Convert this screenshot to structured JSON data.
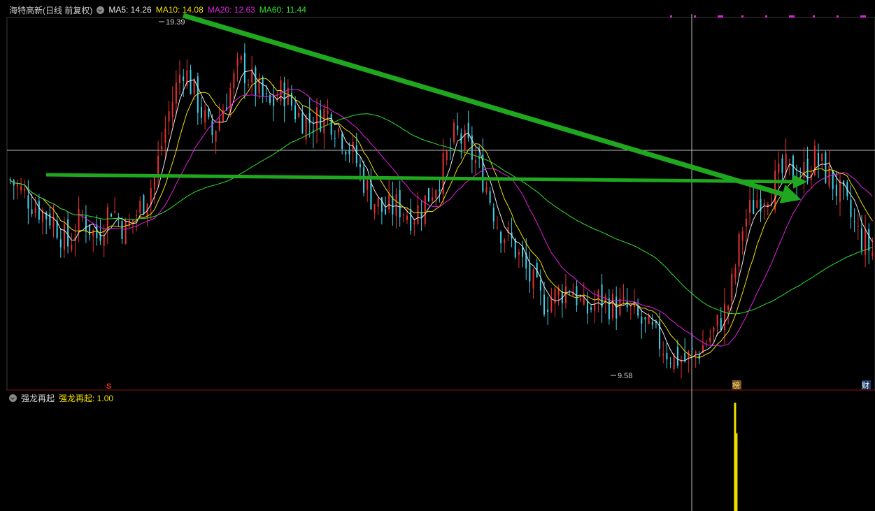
{
  "stock_title": "海特高新(日线 前复权)",
  "ma_labels": [
    {
      "text": "MA5: 14.26",
      "color": "#e8e8e8"
    },
    {
      "text": "MA10: 14.08",
      "color": "#f0e000"
    },
    {
      "text": "MA20: 12.63",
      "color": "#e020e0"
    },
    {
      "text": "MA60: 11.44",
      "color": "#30e030"
    }
  ],
  "indicator_title": "强龙再起",
  "indicator_value_label": "强龙再起: 1.00",
  "price_high_label": "19.39",
  "price_low_label": "9.58",
  "badges": {
    "left": "S",
    "mid": "榜",
    "right": "财"
  },
  "colors": {
    "up": "#e83030",
    "down": "#40d0e8",
    "ma5": "#e8e8e8",
    "ma10": "#f0e000",
    "ma20": "#e020e0",
    "ma60": "#30e030",
    "arrow": "#1fa81f",
    "signal": "#f0e000"
  },
  "chart_data": {
    "type": "candlestick",
    "series": [
      {
        "name": "MA5",
        "value": 14.26
      },
      {
        "name": "MA10",
        "value": 14.08
      },
      {
        "name": "MA20",
        "value": 12.63
      },
      {
        "name": "MA60",
        "value": 11.44
      }
    ],
    "marked_high": 19.39,
    "marked_low": 9.58,
    "close_path": [
      15.0,
      14.6,
      14.2,
      13.9,
      13.2,
      14.0,
      13.4,
      14.3,
      13.6,
      14.2,
      15.0,
      16.8,
      18.2,
      17.2,
      16.2,
      17.2,
      18.2,
      17.6,
      17.0,
      17.5,
      16.8,
      16.6,
      16.9,
      16.3,
      15.6,
      14.6,
      14.1,
      14.3,
      14.0,
      14.5,
      15.2,
      16.3,
      15.8,
      15.0,
      13.7,
      13.2,
      12.4,
      11.6,
      11.8,
      12.1,
      11.3,
      11.7,
      11.5,
      11.4,
      11.0,
      10.6,
      10.1,
      10.0,
      10.3,
      10.8,
      11.6,
      13.8,
      14.5,
      14.8,
      15.3,
      15.1,
      15.6,
      15.1,
      14.4,
      13.5,
      13.0
    ],
    "indicator": {
      "name": "强龙再起",
      "value": 1.0,
      "signal_at": 0.838,
      "ylim": [
        0,
        1
      ]
    }
  }
}
